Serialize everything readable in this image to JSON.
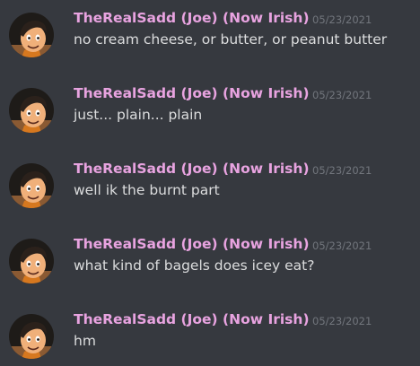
{
  "colors": {
    "background": "#36393f",
    "username": "#e8a3e0",
    "text": "#dcddde",
    "timestamp": "#72767d"
  },
  "messages": [
    {
      "author": "TheRealSadd (Joe) (Now Irish)",
      "timestamp": "05/23/2021",
      "content": "no cream cheese, or butter, or peanut butter",
      "avatar_icon": "cartoon-boy-avatar-icon"
    },
    {
      "author": "TheRealSadd (Joe) (Now Irish)",
      "timestamp": "05/23/2021",
      "content": "just... plain... plain",
      "avatar_icon": "cartoon-boy-avatar-icon"
    },
    {
      "author": "TheRealSadd (Joe) (Now Irish)",
      "timestamp": "05/23/2021",
      "content": "well ik the burnt part",
      "avatar_icon": "cartoon-boy-avatar-icon"
    },
    {
      "author": "TheRealSadd (Joe) (Now Irish)",
      "timestamp": "05/23/2021",
      "content": "what kind of bagels does icey eat?",
      "avatar_icon": "cartoon-boy-avatar-icon"
    },
    {
      "author": "TheRealSadd (Joe) (Now Irish)",
      "timestamp": "05/23/2021",
      "content": "hm",
      "avatar_icon": "cartoon-boy-avatar-icon"
    }
  ]
}
